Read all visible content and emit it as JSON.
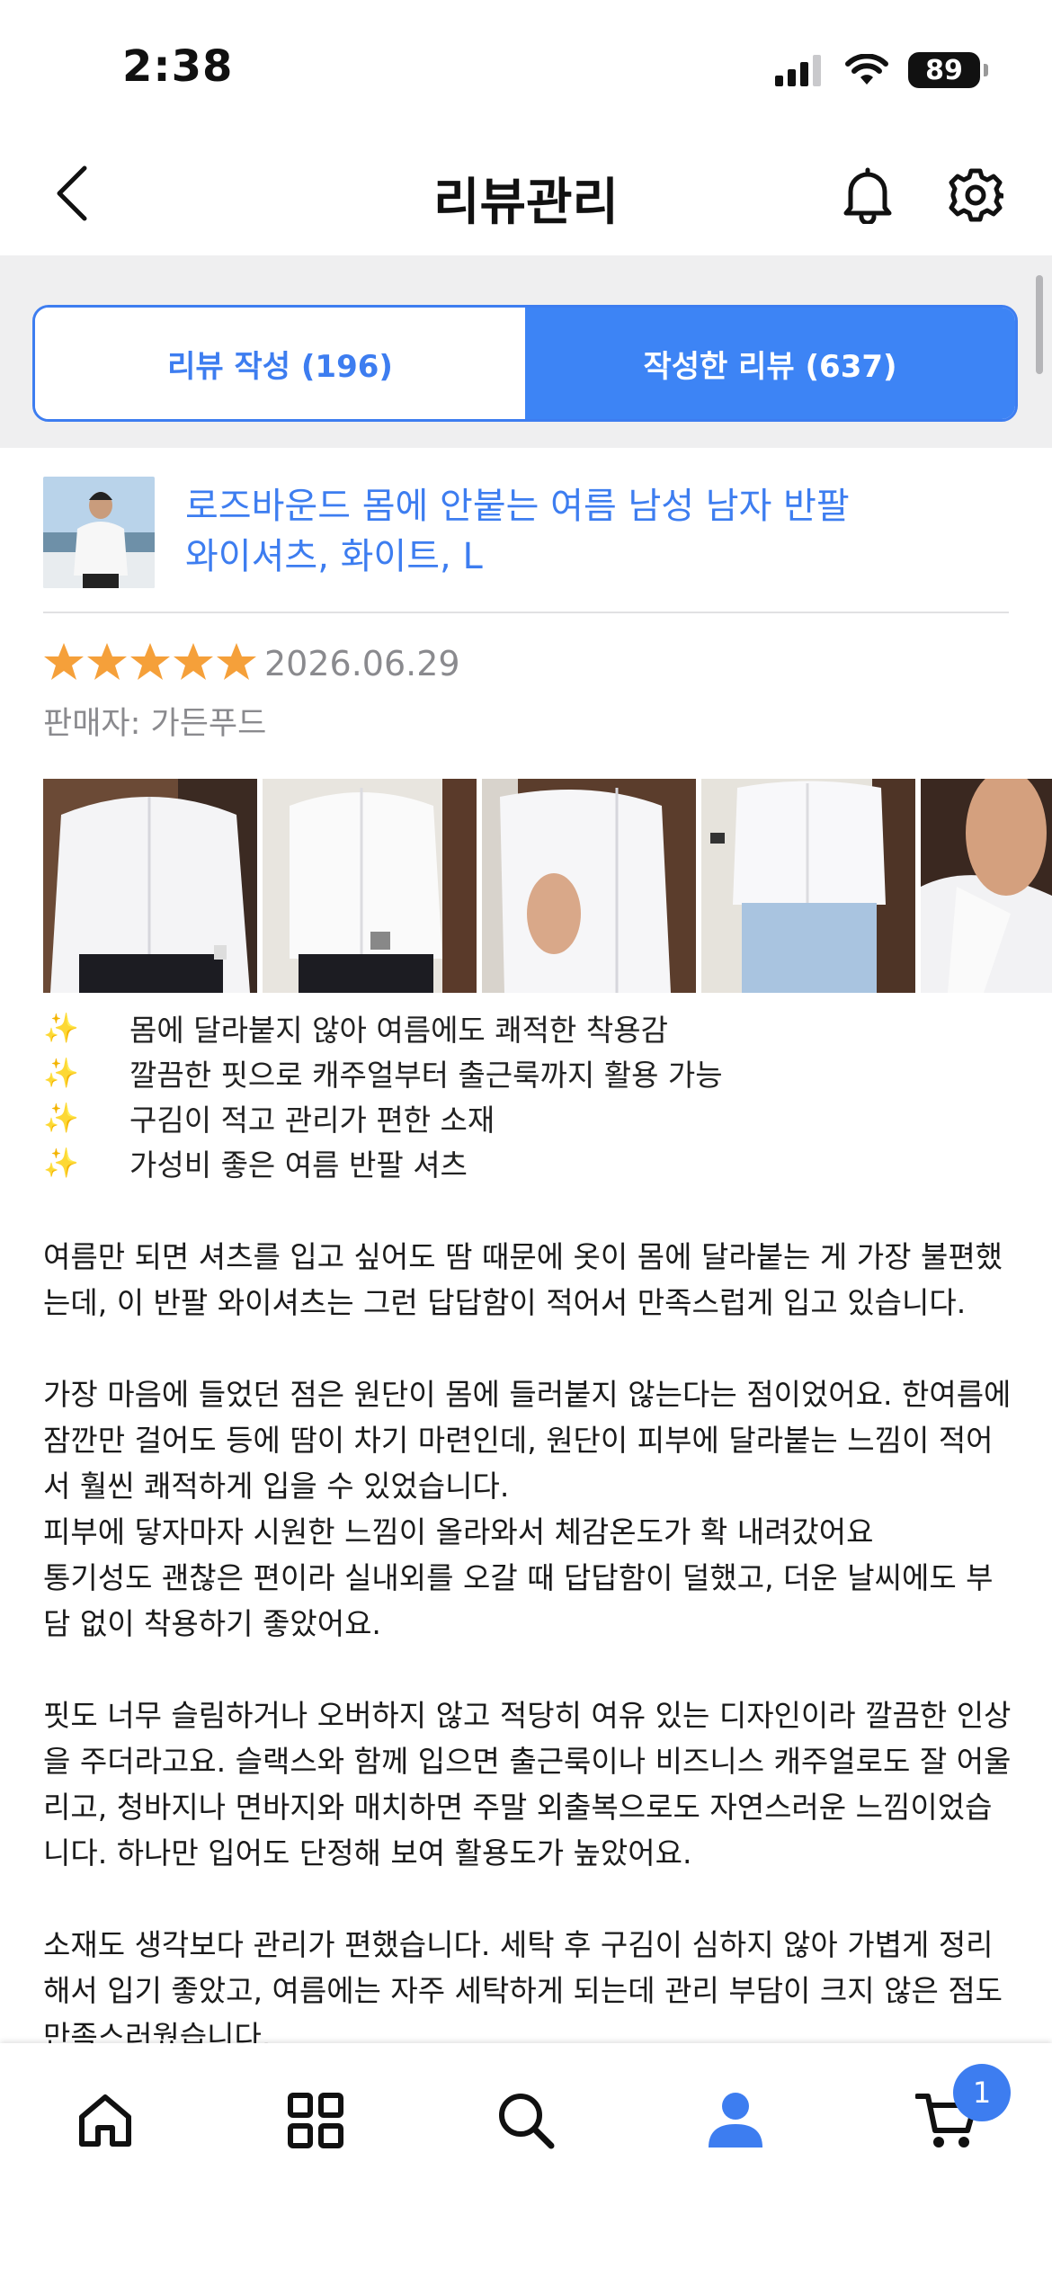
{
  "status_bar": {
    "time": "2:38",
    "battery": "89"
  },
  "header": {
    "title": "리뷰관리"
  },
  "tabs": [
    {
      "label": "리뷰 작성 (196)",
      "active": false
    },
    {
      "label": "작성한 리뷰 (637)",
      "active": true
    }
  ],
  "review": {
    "product_name_line1": "로즈바운드 몸에 안붙는 여름 남성 남자 반팔",
    "product_name_line2": "와이셔츠, 화이트, L",
    "rating": 5,
    "date": "2026.06.29",
    "seller_label": "판매자: 가든푸드",
    "photo_count_visible": 5,
    "highlights": [
      "몸에 달라붙지 않아 여름에도 쾌적한 착용감",
      "깔끔한 핏으로 캐주얼부터 출근룩까지 활용 가능",
      "구김이 적고 관리가 편한 소재",
      "가성비 좋은 여름 반팔 셔츠"
    ],
    "paragraphs": [
      "여름만 되면 셔츠를 입고 싶어도 땀 때문에 옷이 몸에 달라붙는 게 가장 불편했는데, 이 반팔 와이셔츠는 그런 답답함이 적어서 만족스럽게 입고 있습니다.",
      "가장 마음에 들었던 점은 원단이 몸에 들러붙지 않는다는 점이었어요. 한여름에 잠깐만 걸어도 등에 땀이 차기 마련인데, 원단이 피부에 달라붙는 느낌이 적어서 훨씬 쾌적하게 입을 수 있었습니다.",
      "피부에 닿자마자 시원한 느낌이 올라와서 체감온도가 확 내려갔어요",
      "통기성도 괜찮은 편이라 실내외를 오갈 때 답답함이 덜했고, 더운 날씨에도 부담 없이 착용하기 좋았어요.",
      "핏도 너무 슬림하거나 오버하지 않고 적당히 여유 있는 디자인이라 깔끔한 인상을 주더라고요. 슬랙스와 함께 입으면 출근룩이나 비즈니스 캐주얼로도 잘 어울리고, 청바지나 면바지와 매치하면 주말 외출복으로도 자연스러운 느낌이었습니다. 하나만 입어도 단정해 보여 활용도가 높았어요.",
      "소재도 생각보다 관리가 편했습니다. 세탁 후 구김이 심하지 않아 가볍게 정리해서 입기 좋았고, 여름에는 자주 세탁하게 되는데 관리 부담이 크지 않은 점도 만족스러웠습니다."
    ]
  },
  "bottom_nav": {
    "items": [
      "home-icon",
      "category-grid-icon",
      "search-icon",
      "profile-icon",
      "cart-icon"
    ],
    "cart_badge": "1",
    "active_index": 3
  },
  "colors": {
    "accent": "#3d7df0",
    "star": "#f5a03a",
    "muted": "#8a8a8e"
  }
}
